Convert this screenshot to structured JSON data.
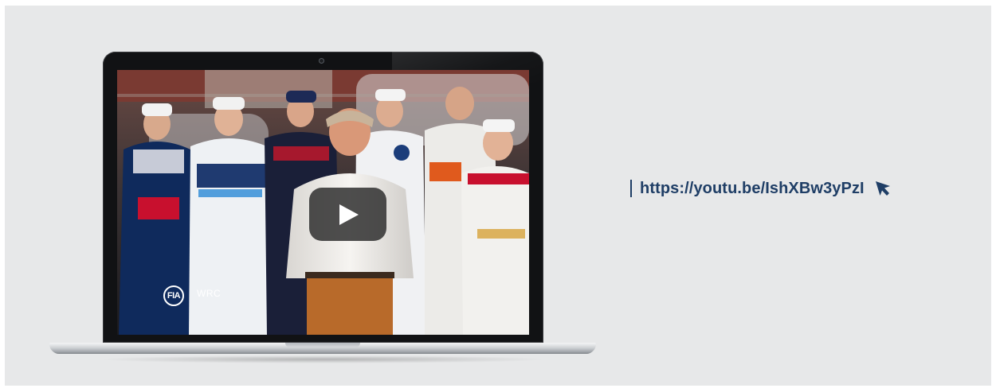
{
  "link": {
    "url": "https://youtu.be/IshXBw3yPzI",
    "cursor_icon": "mouse-pointer-arrow-icon"
  },
  "video": {
    "play_icon": "play-icon",
    "overlay_logos": {
      "fia": "FIA",
      "wrc": "WRC"
    }
  },
  "colors": {
    "background": "#e7e8e9",
    "link": "#1f3e66",
    "laptop_bezel": "#111214",
    "play_button": "#282828"
  }
}
